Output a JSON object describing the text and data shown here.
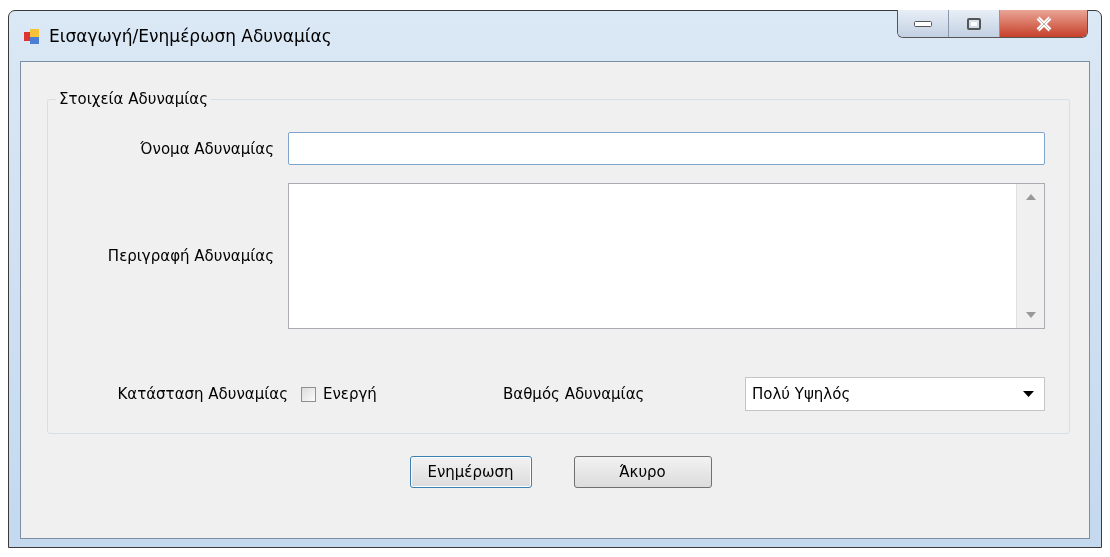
{
  "window": {
    "title": "Εισαγωγή/Ενημέρωση Αδυναμίας"
  },
  "group": {
    "title": "Στοιχεία Αδυναμίας",
    "name_field": {
      "label": "Όνομα Αδυναμίας"
    },
    "description_field": {
      "label": "Περιγραφή Αδυναμίας"
    },
    "status": {
      "label": "Κατάσταση Αδυναμίας",
      "checkbox_label": "Ενεργή",
      "checked": false
    },
    "severity": {
      "label": "Βαθμός Αδυναμίας",
      "value": "Πολύ Υψηλός"
    }
  },
  "buttons": [
    {
      "label": "Ενημέρωση",
      "selected": true
    },
    {
      "label": "Άκυρο",
      "selected": false
    }
  ]
}
